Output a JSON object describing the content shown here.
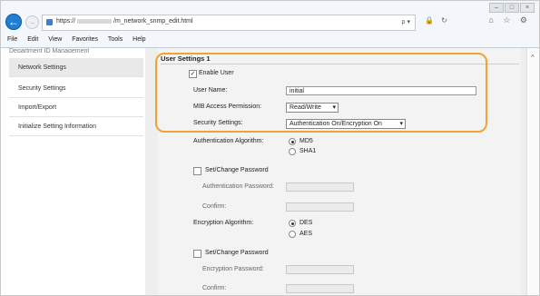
{
  "browser": {
    "url_prefix": "https://",
    "url_suffix": "/m_network_snmp_edit.html",
    "url_search": "ρ ▾",
    "tab_icons": "🔒 ↻",
    "menu": [
      "File",
      "Edit",
      "View",
      "Favorites",
      "Tools",
      "Help"
    ],
    "window_controls": [
      "–",
      "□",
      "×"
    ],
    "right_icons": "⌂ ☆ ⚙"
  },
  "sidebar": {
    "cut_label": "Department ID Management",
    "items": [
      {
        "label": "Network Settings"
      },
      {
        "label": "Security Settings"
      },
      {
        "label": "Import/Export"
      },
      {
        "label": "Initialize Setting Information"
      }
    ]
  },
  "form": {
    "section_title": "User Settings 1",
    "enable_user_label": "Enable User",
    "enable_user_checked": "✓",
    "user_name_label": "User Name:",
    "user_name_value": "initial",
    "mib_label": "MIB Access Permission:",
    "mib_value": "Read/Write",
    "security_label": "Security Settings:",
    "security_value": "Authentication On/Encryption On",
    "auth_algo_label": "Authentication Algorithm:",
    "auth_algo_options": [
      "MD5",
      "SHA1"
    ],
    "set_pw_label": "Set/Change Password",
    "auth_pw_label": "Authentication Password:",
    "confirm_label": "Confirm:",
    "enc_algo_label": "Encryption Algorithm:",
    "enc_algo_options": [
      "DES",
      "AES"
    ],
    "set_pw2_label": "Set/Change Password",
    "enc_pw_label": "Encryption Password:",
    "confirm2_label": "Confirm:"
  },
  "colors": {
    "highlight": "#f0a330",
    "back_button": "#1e7fd4"
  }
}
